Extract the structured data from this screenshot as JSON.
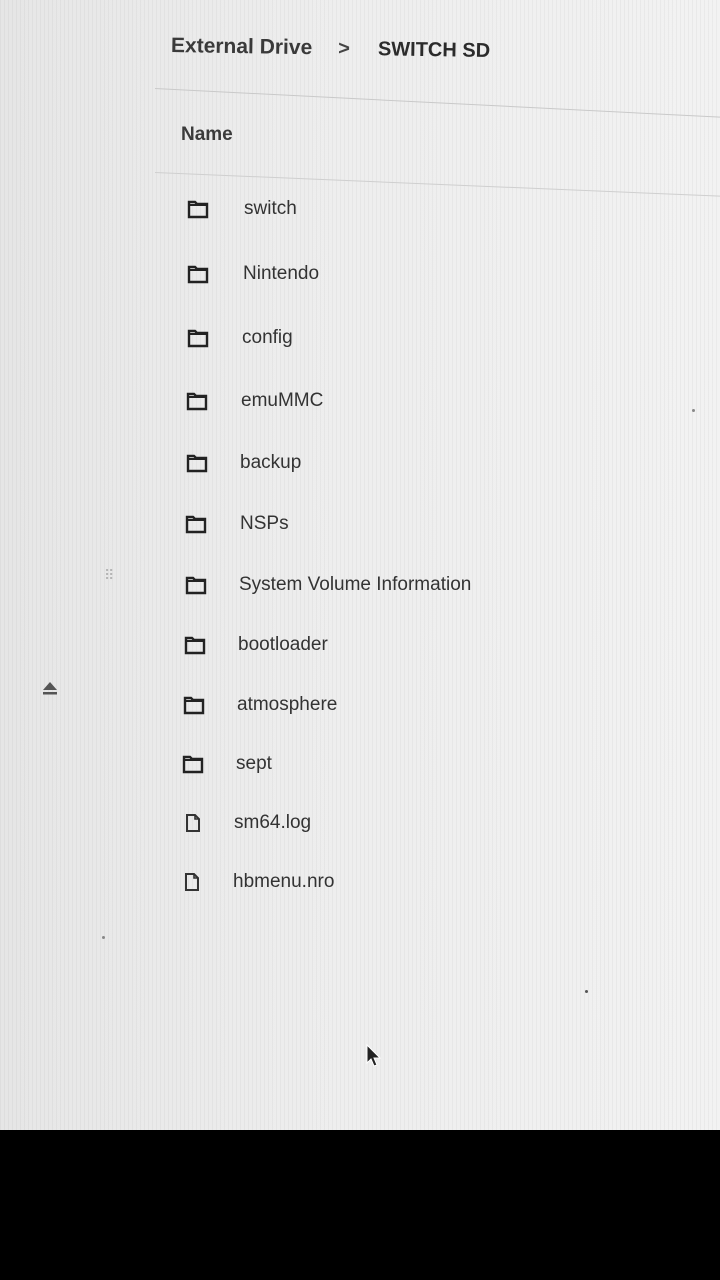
{
  "breadcrumb": {
    "root": "External Drive",
    "separator": ">",
    "current": "SWITCH SD"
  },
  "list": {
    "column_header": "Name",
    "items": [
      {
        "name": "switch",
        "type": "folder"
      },
      {
        "name": "Nintendo",
        "type": "folder"
      },
      {
        "name": "config",
        "type": "folder"
      },
      {
        "name": "emuMMC",
        "type": "folder"
      },
      {
        "name": "backup",
        "type": "folder"
      },
      {
        "name": "NSPs",
        "type": "folder"
      },
      {
        "name": "System Volume Information",
        "type": "folder"
      },
      {
        "name": "bootloader",
        "type": "folder"
      },
      {
        "name": "atmosphere",
        "type": "folder"
      },
      {
        "name": "sept",
        "type": "folder"
      },
      {
        "name": "sm64.log",
        "type": "file"
      },
      {
        "name": "hbmenu.nro",
        "type": "file"
      }
    ]
  },
  "sidebar": {
    "eject_icon": "eject-icon",
    "drag_handle_icon": "drag-handle-icon"
  },
  "colors": {
    "text": "#333333",
    "background": "#ededed"
  }
}
